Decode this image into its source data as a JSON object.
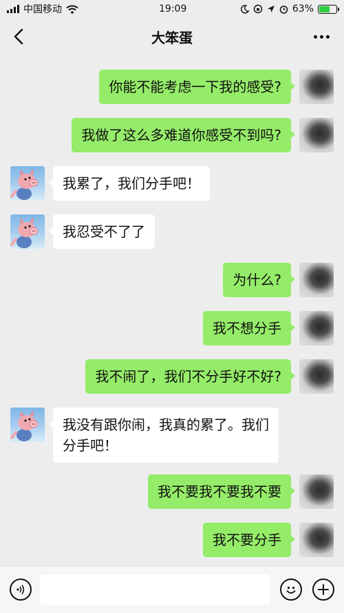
{
  "status_bar": {
    "carrier": "中国移动",
    "time": "19:09",
    "battery_percent": "63%",
    "battery_level": 0.63
  },
  "nav": {
    "title": "大笨蛋",
    "back_icon": "chevron-left-icon",
    "more_icon": "more-dots-icon"
  },
  "messages": [
    {
      "side": "sent",
      "text": "你能不能考虑一下我的感受?"
    },
    {
      "side": "sent",
      "text": "我做了这么多难道你感受不到吗?"
    },
    {
      "side": "recv",
      "text": "我累了，我们分手吧！"
    },
    {
      "side": "recv",
      "text": "我忍受不了了"
    },
    {
      "side": "sent",
      "text": "为什么?"
    },
    {
      "side": "sent",
      "text": "我不想分手"
    },
    {
      "side": "sent",
      "text": "我不闹了，我们不分手好不好?"
    },
    {
      "side": "recv",
      "text_line1": "我没有跟你闹，我真的累了。我们",
      "text_line2": "分手吧！"
    },
    {
      "side": "sent",
      "text": "我不要我不要我不要"
    },
    {
      "side": "sent",
      "text": "我不要分手"
    }
  ],
  "input_bar": {
    "value": "",
    "voice_icon": "voice-icon",
    "emoji_icon": "emoji-icon",
    "add_icon": "plus-icon"
  },
  "colors": {
    "sent_bubble": "#95ec69",
    "recv_bubble": "#ffffff",
    "background": "#ededed"
  }
}
